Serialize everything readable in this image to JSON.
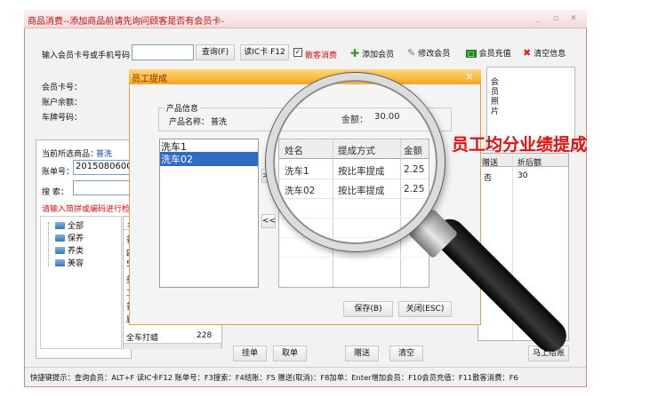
{
  "window": {
    "title": "商品消费--添加商品前请先询问顾客是否有会员卡-",
    "min": "_",
    "restore": "▫",
    "close": "✕"
  },
  "toolbar": {
    "member_input_label": "输入会员卡号或手机号码",
    "query_btn": "查询(F)",
    "readcard_btn": "读IC卡 F12",
    "scatter_check": "✓",
    "scatter_label": "散客消费",
    "add_member": "添加会员",
    "edit_member": "修改会员",
    "recharge": "会员充值",
    "clear_info": "清空信息"
  },
  "member": {
    "card_label": "会员卡号：",
    "balance_label": "账户余额：",
    "plate_label": "车牌号码：",
    "photo_label": "会员照片"
  },
  "product": {
    "current_label": "当前所选商品：",
    "current_value": "普洗",
    "order_label": "账单号：",
    "order_value": "2015080600",
    "search_label": "搜  索：",
    "hint": "请输入简拼或编码进行检索"
  },
  "tree": [
    {
      "label": "全部",
      "icon": "folder-icon"
    },
    {
      "label": "保养",
      "icon": "folder-icon"
    },
    {
      "label": "养类",
      "icon": "folder-icon"
    },
    {
      "label": "美容",
      "icon": "folder-icon"
    }
  ],
  "left_list": {
    "header_fragment": "名",
    "rows": [
      "普",
      "四",
      "5",
      "美",
      "工",
      "普",
      "顾"
    ],
    "last_name": "全车打蜡",
    "last_value": "228"
  },
  "right_grid": {
    "headers": [
      "赠送",
      "折后额"
    ],
    "row": [
      "否",
      "30"
    ]
  },
  "bottom_buttons": {
    "hold": "挂单",
    "take": "取单",
    "gift": "赠送",
    "clear": "清空",
    "checkout": "马上结账"
  },
  "status": "快捷键提示：查询会员：ALT+F 读IC卡F12 账单号：F3搜索：F4结账：F5 赠送(取消)：F8加单：Enter增加会员：F10会员充值：F11散客消费：F6",
  "dialog": {
    "title": "员工提成",
    "close": "×",
    "info_group": "产品信息",
    "product_name_label": "产品名称：",
    "product_name": "普洗",
    "amount_label": "金额：",
    "amount": "30.00",
    "employees": [
      "洗车1",
      "洗车02"
    ],
    "arrow_right": ">>",
    "arrow_left": "<<",
    "table_headers": [
      "姓名",
      "提成方式",
      "金额"
    ],
    "table_rows": [
      [
        "洗车1",
        "按比率提成",
        "2.25"
      ],
      [
        "洗车02",
        "按比率提成",
        "2.25"
      ]
    ],
    "save_btn": "保存(B)",
    "close_btn": "关闭(ESC)"
  },
  "annotation": "员工均分业绩提成",
  "colors": {
    "title_red": "#c01010",
    "hint_red": "#d01010",
    "selection": "#316ac5",
    "dialog_bar": "#f2a920",
    "annotation": "#e01010"
  }
}
